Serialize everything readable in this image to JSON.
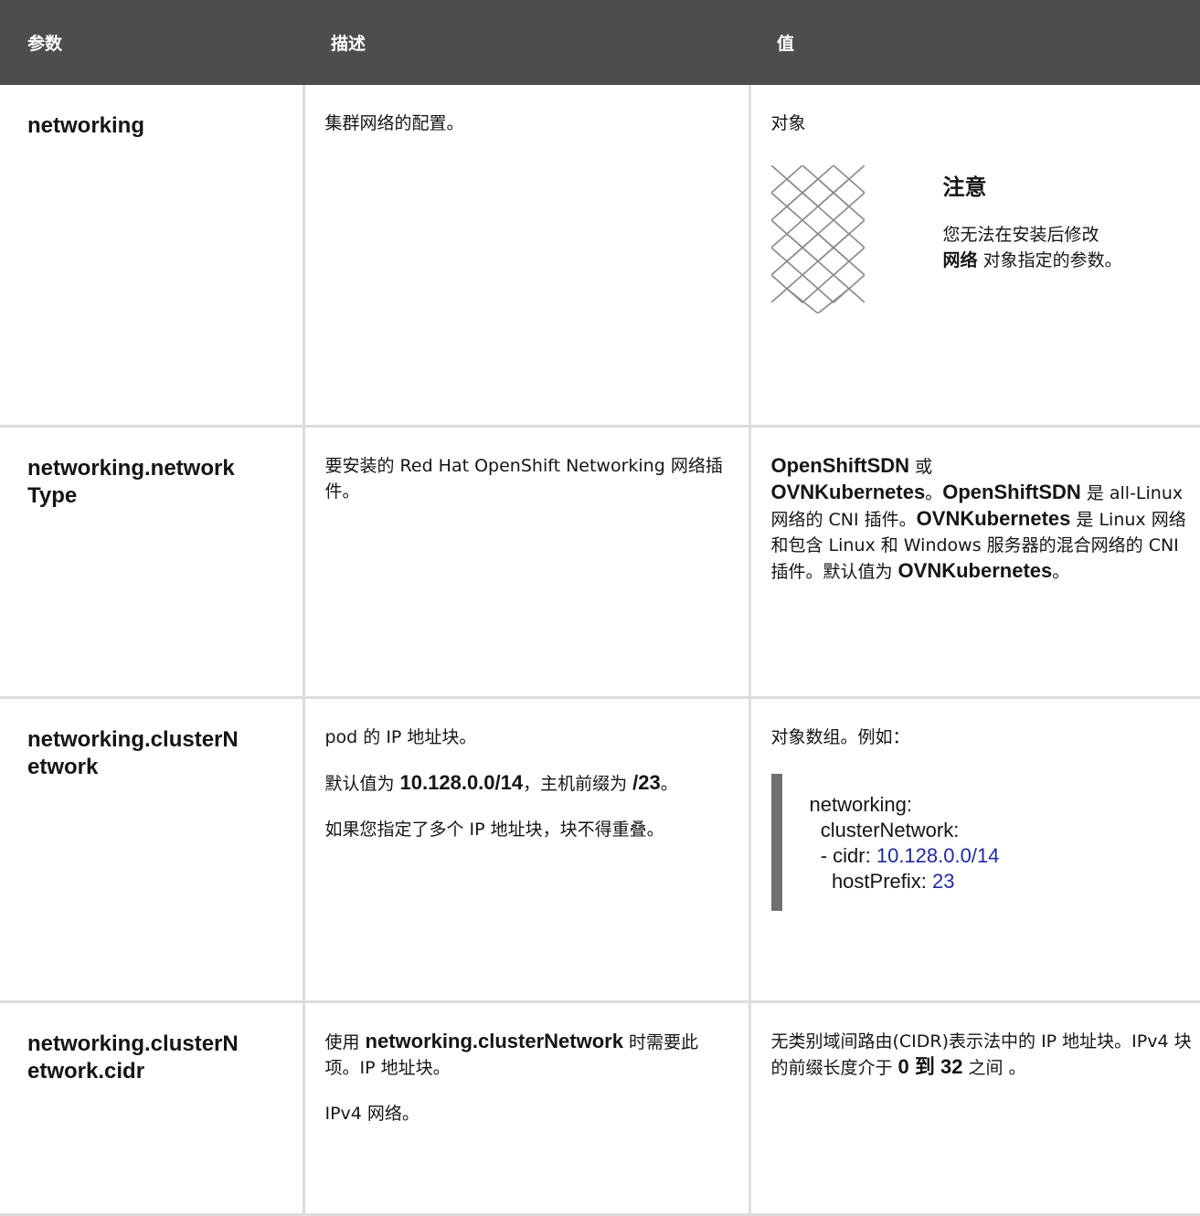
{
  "header": {
    "col1": "参数",
    "col2": "描述",
    "col3": "值"
  },
  "rows": [
    {
      "param": "networking",
      "desc": "集群网络的配置。",
      "value": "对象",
      "note": {
        "title": "注意",
        "text_1": "您无法在安装后修改",
        "text_bold": "网络",
        "text_2": "对象指定的参数。"
      }
    },
    {
      "param_line1": "networking.network",
      "param_line2": "Type",
      "desc": "要安装的 Red Hat OpenShift Networking 网络插件。",
      "value_parts": {
        "b1": "OpenShiftSDN",
        "t1": " 或 ",
        "b2": "OVNKubernetes",
        "t2": "。",
        "b3": "OpenShiftSDN",
        "t3": " 是 all-Linux 网络的 CNI 插件。",
        "b4": "OVNKubernetes",
        "t4": " 是 Linux 网络和包含 Linux 和 Windows 服务器的混合网络的 CNI 插件。默认值为 ",
        "b5": "OVNKubernetes",
        "t5": "。"
      }
    },
    {
      "param_line1": "networking.clusterN",
      "param_line2": "etwork",
      "desc_p1": "pod 的 IP 地址块。",
      "desc_p2_a": "默认值为 ",
      "desc_p2_b": "10.128.0.0/14",
      "desc_p2_c": "，主机前缀为 ",
      "desc_p2_d": "/23",
      "desc_p2_e": "。",
      "desc_p3": "如果您指定了多个 IP 地址块，块不得重叠。",
      "value": "对象数组。例如：",
      "code": {
        "l1": "networking:",
        "l2": "  clusterNetwork:",
        "l3_a": "  - cidr: ",
        "l3_b": "10.128.0.0/14",
        "l4_a": "    hostPrefix: ",
        "l4_b": "23"
      }
    },
    {
      "param_line1": "networking.clusterN",
      "param_line2": "etwork.cidr",
      "desc_p1_a": "使用 ",
      "desc_p1_b": "networking.clusterNetwork",
      "desc_p1_c": " 时需要此项。IP 地址块。",
      "desc_p2": "IPv4 网络。",
      "value_a": "无类别域间路由(CIDR)表示法中的 IP 地址块。IPv4 块的前缀长度介于 ",
      "value_b": "0 到 32",
      "value_c": " 之间 。"
    }
  ]
}
